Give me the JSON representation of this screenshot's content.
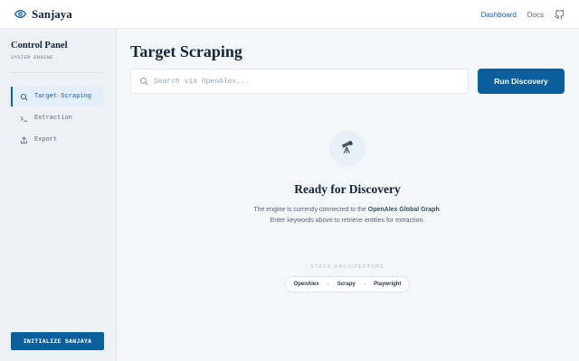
{
  "app": {
    "name": "Sanjaya"
  },
  "topnav": {
    "dashboard": "Dashboard",
    "docs": "Docs"
  },
  "sidebar": {
    "title": "Control Panel",
    "subtitle": "SYSTEM ENGINE",
    "items": [
      {
        "label": "Target Scraping",
        "icon": "search-icon",
        "active": true
      },
      {
        "label": "Extraction",
        "icon": "terminal-icon",
        "active": false
      },
      {
        "label": "Export",
        "icon": "upload-icon",
        "active": false
      }
    ],
    "init_button": "INITIALIZE SANJAYA"
  },
  "main": {
    "title": "Target Scraping",
    "search": {
      "placeholder": "Search via OpenAlex...",
      "value": ""
    },
    "run_button": "Run Discovery",
    "empty_state": {
      "title": "Ready for Discovery",
      "text_before": "The engine is currently connected to the ",
      "text_strong": "OpenAlex Global Graph",
      "text_after": ". Enter keywords above to retrieve entities for extraction."
    },
    "stack": {
      "label": "STACK ARCHITECTURE",
      "items": [
        "OpenAlex",
        "Scrapy",
        "Playwright"
      ]
    }
  },
  "colors": {
    "accent": "#0b5f9c",
    "active_text": "#1460a3",
    "background": "#f4f7fa"
  }
}
